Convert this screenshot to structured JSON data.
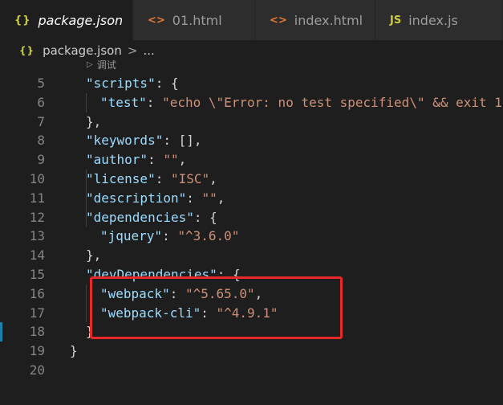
{
  "tabs": [
    {
      "icon": "{}",
      "label": "package.json",
      "close": "✕",
      "active": true
    },
    {
      "icon": "<>",
      "label": "01.html"
    },
    {
      "icon": "<>",
      "label": "index.html"
    },
    {
      "icon": "JS",
      "label": "index.js"
    }
  ],
  "breadcrumb": {
    "icon": "{}",
    "file": "package.json",
    "separator": ">",
    "more": "..."
  },
  "codelens": {
    "label": "调试"
  },
  "lines": [
    {
      "n": "5"
    },
    {
      "n": "6"
    },
    {
      "n": "7"
    },
    {
      "n": "8"
    },
    {
      "n": "9"
    },
    {
      "n": "10"
    },
    {
      "n": "11"
    },
    {
      "n": "12"
    },
    {
      "n": "13"
    },
    {
      "n": "14"
    },
    {
      "n": "15"
    },
    {
      "n": "16"
    },
    {
      "n": "17"
    },
    {
      "n": "18"
    },
    {
      "n": "19"
    },
    {
      "n": "20"
    }
  ],
  "code": {
    "scripts_key": "\"scripts\"",
    "test_key": "\"test\"",
    "test_val": "\"echo \\\"Error: no test specified\\\" && exit 1",
    "keywords_key": "\"keywords\"",
    "author_key": "\"author\"",
    "author_val": "\"\"",
    "license_key": "\"license\"",
    "license_val": "\"ISC\"",
    "description_key": "\"description\"",
    "description_val": "\"\"",
    "dependencies_key": "\"dependencies\"",
    "jquery_key": "\"jquery\"",
    "jquery_val": "\"^3.6.0\"",
    "devdeps_key": "\"devDependencies\"",
    "webpack_key": "\"webpack\"",
    "webpack_val": "\"^5.65.0\"",
    "webpackcli_key": "\"webpack-cli\"",
    "webpackcli_val": "\"^4.9.1\""
  },
  "colors": {
    "highlight_box": "#e8282b",
    "string": "#ce9178",
    "key": "#9cdcfe"
  }
}
